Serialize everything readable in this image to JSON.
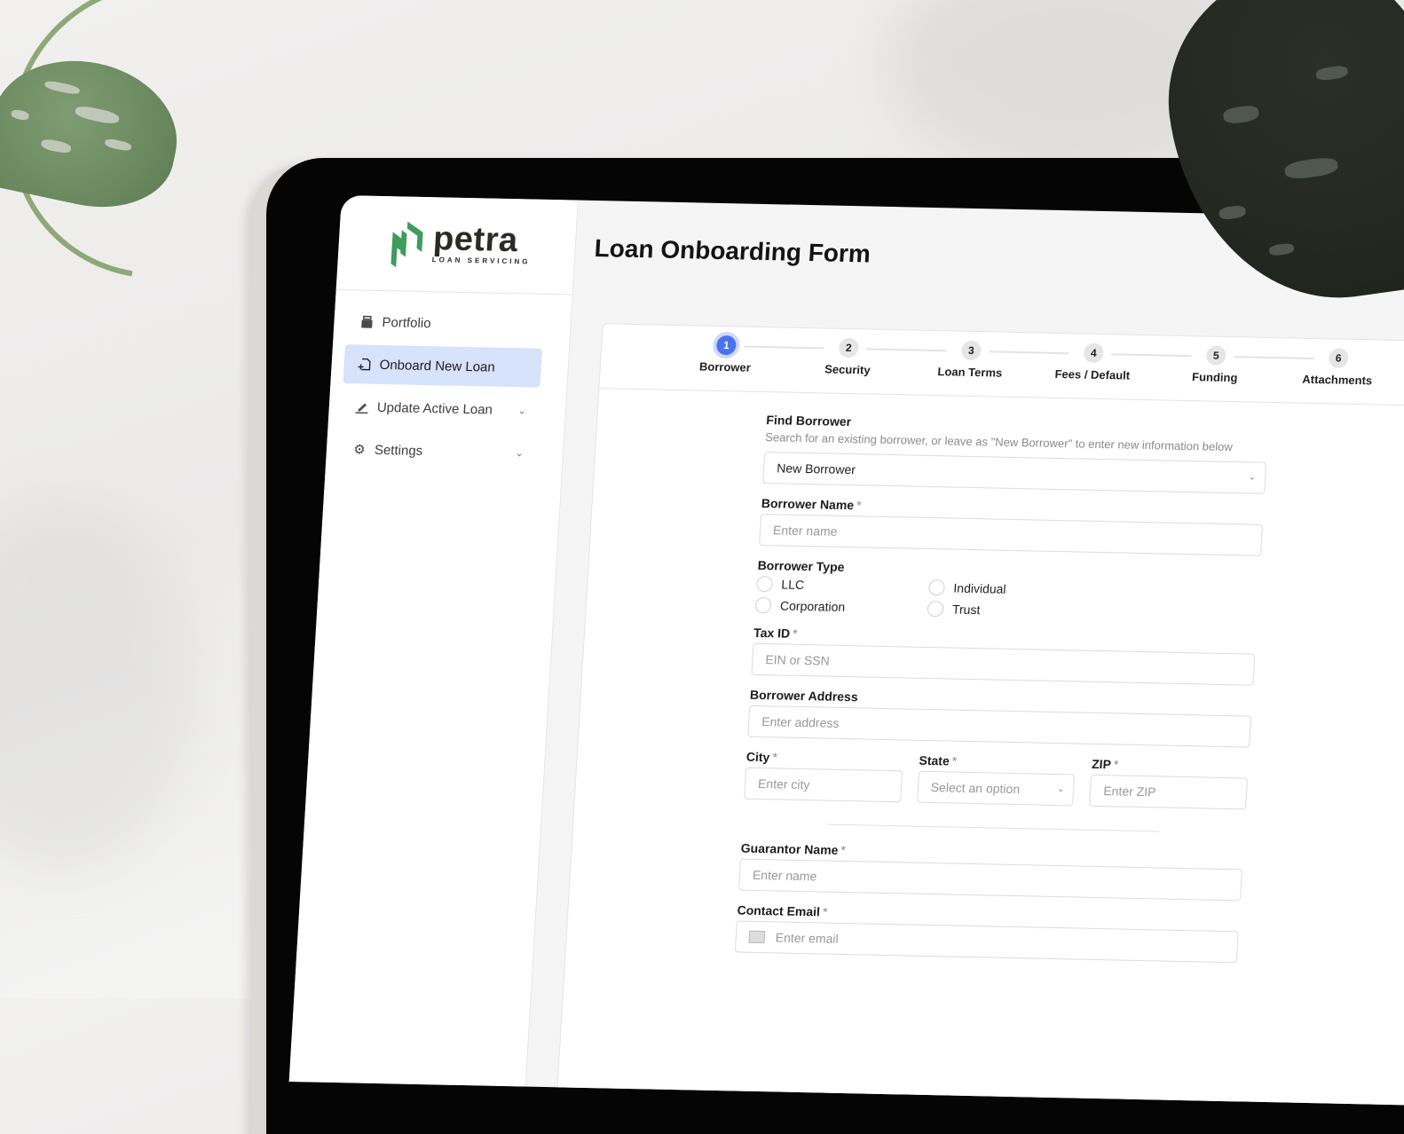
{
  "app": {
    "brand": "petra",
    "brand_tagline": "LOAN SERVICING",
    "brand_color": "#3e9c5c"
  },
  "sidebar": {
    "items": [
      {
        "label": "Portfolio",
        "icon": "folder-open-icon",
        "active": false,
        "has_chevron": false
      },
      {
        "label": "Onboard New Loan",
        "icon": "file-plus-icon",
        "active": true,
        "has_chevron": false
      },
      {
        "label": "Update Active Loan",
        "icon": "pencil-icon",
        "active": false,
        "has_chevron": true
      },
      {
        "label": "Settings",
        "icon": "gear-icon",
        "active": false,
        "has_chevron": true
      }
    ],
    "active_color": "#d7e2fb"
  },
  "main": {
    "title": "Loan Onboarding Form",
    "stepper": {
      "active_color": "#4a72f0",
      "steps": [
        {
          "number": "1",
          "label": "Borrower",
          "active": true
        },
        {
          "number": "2",
          "label": "Security",
          "active": false
        },
        {
          "number": "3",
          "label": "Loan Terms",
          "active": false
        },
        {
          "number": "4",
          "label": "Fees / Default",
          "active": false
        },
        {
          "number": "5",
          "label": "Funding",
          "active": false
        },
        {
          "number": "6",
          "label": "Attachments",
          "active": false
        }
      ]
    },
    "form": {
      "find_borrower": {
        "label": "Find Borrower",
        "help": "Search for an existing borrower, or leave as \"New Borrower\" to enter new information below",
        "value": "New Borrower"
      },
      "borrower_name": {
        "label": "Borrower Name",
        "required": "*",
        "placeholder": "Enter name"
      },
      "borrower_type": {
        "label": "Borrower Type",
        "options": [
          "LLC",
          "Individual",
          "Corporation",
          "Trust"
        ]
      },
      "tax_id": {
        "label": "Tax ID",
        "required": "*",
        "placeholder": "EIN or SSN"
      },
      "borrower_address": {
        "label": "Borrower Address",
        "placeholder": "Enter address"
      },
      "city": {
        "label": "City",
        "required": "*",
        "placeholder": "Enter city"
      },
      "state": {
        "label": "State",
        "required": "*",
        "placeholder": "Select an option"
      },
      "zip": {
        "label": "ZIP",
        "required": "*",
        "placeholder": "Enter ZIP"
      },
      "guarantor_name": {
        "label": "Guarantor Name",
        "required": "*",
        "placeholder": "Enter name"
      },
      "contact_email": {
        "label": "Contact Email",
        "required": "*",
        "placeholder": "Enter email"
      }
    }
  }
}
